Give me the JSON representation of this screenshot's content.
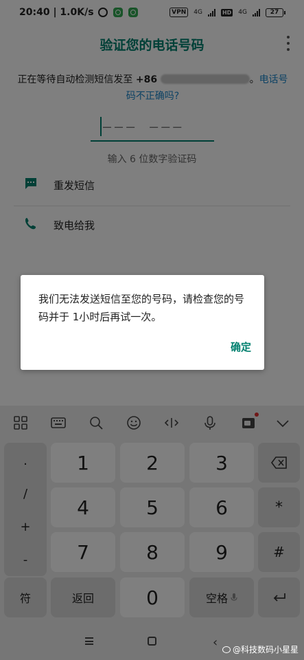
{
  "status_bar": {
    "time_speed": "20:40 | 1.0K/s",
    "vpn": "VPN",
    "net1": "4G",
    "hd": "HD",
    "net2": "4G",
    "battery": "27"
  },
  "header": {
    "title": "验证您的电话号码"
  },
  "verify": {
    "desc_prefix": "正在等待自动检测短信发至 ",
    "phone_prefix": "+86",
    "desc_suffix": "。",
    "wrong_number_link": "电话号码不正确吗?",
    "code_placeholder": "––– –––",
    "hint": "输入 6 位数字验证码"
  },
  "actions": [
    {
      "label": "重发短信",
      "icon": "sms-icon"
    },
    {
      "label": "致电给我",
      "icon": "phone-icon"
    }
  ],
  "dialog": {
    "message": "我们无法发送短信至您的号码，请检查您的号码并于 1小时后再试一次。",
    "ok": "确定"
  },
  "keyboard": {
    "symbols": [
      ".",
      "/",
      "+",
      "-"
    ],
    "digits": [
      "1",
      "2",
      "3",
      "4",
      "5",
      "6",
      "7",
      "8",
      "9",
      "0"
    ],
    "side_keys": [
      "*",
      "#"
    ],
    "fn_keys": {
      "sym": "符",
      "back": "返回",
      "space": "空格"
    }
  },
  "watermark": "@科技数码小星星",
  "colors": {
    "accent": "#00806f",
    "link": "#1a85c8"
  }
}
